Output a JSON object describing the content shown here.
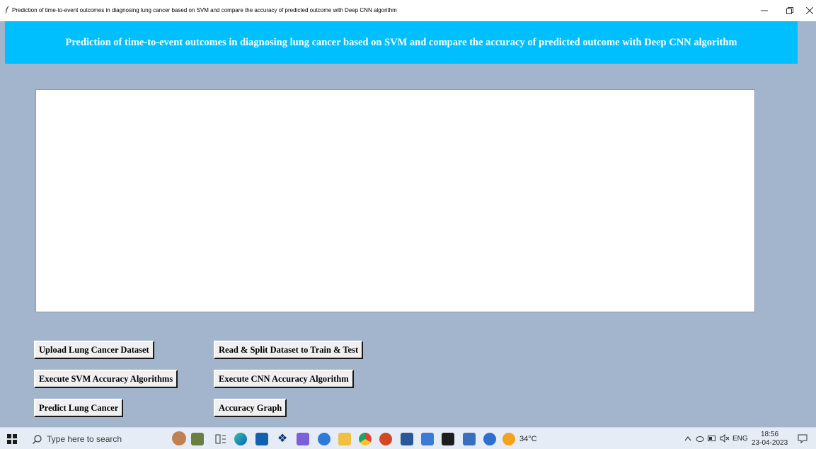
{
  "window": {
    "title": "Prediction of time-to-event outcomes in diagnosing lung cancer based on  SVM and compare the accuracy of predicted outcome with Deep CNN algorithm",
    "minimize": "–",
    "maximize": "❐",
    "close": "✕"
  },
  "banner": {
    "text": "Prediction of time-to-event outcomes in diagnosing lung cancer based on  SVM and compare the accuracy of predicted outcome with Deep CNN algorithm",
    "color": "#00bfff"
  },
  "output": {
    "value": ""
  },
  "buttons": {
    "upload": "Upload Lung Cancer Dataset",
    "read_split": "Read & Split Dataset to Train & Test",
    "svm": "Execute SVM Accuracy Algorithms",
    "cnn": "Execute CNN Accuracy Algorithm",
    "predict": "Predict Lung Cancer",
    "graph": "Accuracy Graph"
  },
  "colors": {
    "background": "#a2b5cd",
    "button_face": "#f0f0f0"
  },
  "taskbar": {
    "search_placeholder": "Type here to search",
    "weather": "34°C",
    "language": "ENG",
    "time": "18:56",
    "date": "23-04-2023",
    "apps": [
      "avatar-icon",
      "city-icon",
      "task-view-icon",
      "edge-icon",
      "mail-icon",
      "dropbox-icon",
      "app-s-icon",
      "app-icon",
      "file-explorer-icon",
      "chrome-icon",
      "powerpoint-icon",
      "word-icon",
      "app-icon",
      "terminal-icon",
      "app-icon",
      "help-icon",
      "weather-icon"
    ]
  }
}
